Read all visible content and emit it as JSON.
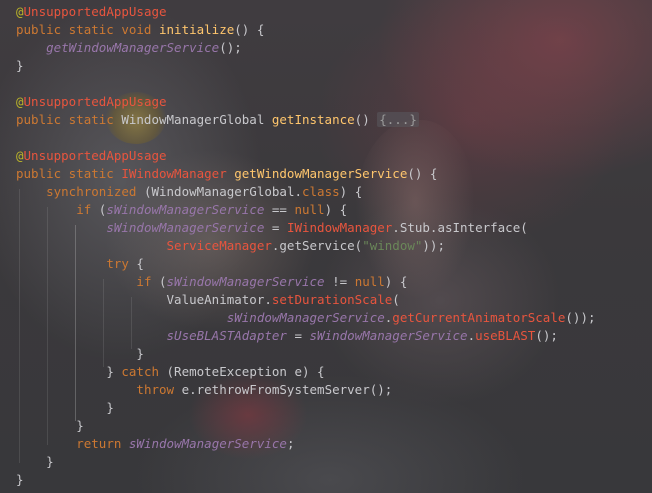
{
  "code": {
    "lines": [
      {
        "tokens": [
          {
            "t": "@",
            "c": "anno"
          },
          {
            "t": "UnsupportedAppUsage",
            "c": "annoname"
          }
        ]
      },
      {
        "tokens": [
          {
            "t": "public static void ",
            "c": "kw"
          },
          {
            "t": "initialize",
            "c": "fn"
          },
          {
            "t": "() {",
            "c": "txt"
          }
        ]
      },
      {
        "tokens": [
          {
            "t": "    ",
            "c": "txt"
          },
          {
            "t": "getWindowManagerService",
            "c": "field"
          },
          {
            "t": "();",
            "c": "txt"
          }
        ]
      },
      {
        "tokens": [
          {
            "t": "}",
            "c": "txt"
          }
        ]
      },
      {
        "tokens": []
      },
      {
        "tokens": [
          {
            "t": "@",
            "c": "anno"
          },
          {
            "t": "UnsupportedAppUsage",
            "c": "annoname"
          }
        ]
      },
      {
        "tokens": [
          {
            "t": "public static ",
            "c": "kw"
          },
          {
            "t": "WindowManagerGlobal ",
            "c": "txt"
          },
          {
            "t": "getInstance",
            "c": "fn"
          },
          {
            "t": "() ",
            "c": "txt"
          },
          {
            "t": "{...}",
            "c": "fold"
          }
        ]
      },
      {
        "tokens": []
      },
      {
        "tokens": [
          {
            "t": "@",
            "c": "anno"
          },
          {
            "t": "UnsupportedAppUsage",
            "c": "annoname"
          }
        ]
      },
      {
        "tokens": [
          {
            "t": "public static ",
            "c": "kw"
          },
          {
            "t": "IWindowManager ",
            "c": "cls"
          },
          {
            "t": "getWindowManagerService",
            "c": "fn"
          },
          {
            "t": "() {",
            "c": "txt"
          }
        ]
      },
      {
        "tokens": [
          {
            "t": "    ",
            "c": "txt"
          },
          {
            "t": "synchronized ",
            "c": "kw"
          },
          {
            "t": "(WindowManagerGlobal.",
            "c": "txt"
          },
          {
            "t": "class",
            "c": "kw"
          },
          {
            "t": ") {",
            "c": "txt"
          }
        ]
      },
      {
        "tokens": [
          {
            "t": "        ",
            "c": "txt"
          },
          {
            "t": "if ",
            "c": "kw"
          },
          {
            "t": "(",
            "c": "txt"
          },
          {
            "t": "sWindowManagerService",
            "c": "field"
          },
          {
            "t": " == ",
            "c": "txt"
          },
          {
            "t": "null",
            "c": "kw"
          },
          {
            "t": ") {",
            "c": "txt"
          }
        ]
      },
      {
        "tokens": [
          {
            "t": "            ",
            "c": "txt"
          },
          {
            "t": "sWindowManagerService",
            "c": "field"
          },
          {
            "t": " = ",
            "c": "txt"
          },
          {
            "t": "IWindowManager",
            "c": "cls"
          },
          {
            "t": ".Stub.asInterface(",
            "c": "txt"
          }
        ]
      },
      {
        "tokens": [
          {
            "t": "                    ",
            "c": "txt"
          },
          {
            "t": "ServiceManager",
            "c": "cls"
          },
          {
            "t": ".getService(",
            "c": "txt"
          },
          {
            "t": "\"window\"",
            "c": "str"
          },
          {
            "t": "));",
            "c": "txt"
          }
        ]
      },
      {
        "tokens": [
          {
            "t": "            ",
            "c": "txt"
          },
          {
            "t": "try ",
            "c": "kw"
          },
          {
            "t": "{",
            "c": "txt"
          }
        ]
      },
      {
        "tokens": [
          {
            "t": "                ",
            "c": "txt"
          },
          {
            "t": "if ",
            "c": "kw"
          },
          {
            "t": "(",
            "c": "txt"
          },
          {
            "t": "sWindowManagerService",
            "c": "field"
          },
          {
            "t": " != ",
            "c": "txt"
          },
          {
            "t": "null",
            "c": "kw"
          },
          {
            "t": ") {",
            "c": "txt"
          }
        ]
      },
      {
        "tokens": [
          {
            "t": "                    ",
            "c": "txt"
          },
          {
            "t": "ValueAnimator.",
            "c": "txt"
          },
          {
            "t": "setDurationScale",
            "c": "call"
          },
          {
            "t": "(",
            "c": "txt"
          }
        ]
      },
      {
        "tokens": [
          {
            "t": "                            ",
            "c": "txt"
          },
          {
            "t": "sWindowManagerService",
            "c": "field"
          },
          {
            "t": ".",
            "c": "txt"
          },
          {
            "t": "getCurrentAnimatorScale",
            "c": "call"
          },
          {
            "t": "());",
            "c": "txt"
          }
        ]
      },
      {
        "tokens": [
          {
            "t": "                    ",
            "c": "txt"
          },
          {
            "t": "sUseBLASTAdapter",
            "c": "field"
          },
          {
            "t": " = ",
            "c": "txt"
          },
          {
            "t": "sWindowManagerService",
            "c": "field"
          },
          {
            "t": ".",
            "c": "txt"
          },
          {
            "t": "useBLAST",
            "c": "call"
          },
          {
            "t": "();",
            "c": "txt"
          }
        ]
      },
      {
        "tokens": [
          {
            "t": "                ",
            "c": "txt"
          },
          {
            "t": "}",
            "c": "txt"
          }
        ]
      },
      {
        "tokens": [
          {
            "t": "            ",
            "c": "txt"
          },
          {
            "t": "} ",
            "c": "txt"
          },
          {
            "t": "catch ",
            "c": "kw"
          },
          {
            "t": "(RemoteException e) {",
            "c": "txt"
          }
        ]
      },
      {
        "tokens": [
          {
            "t": "                ",
            "c": "txt"
          },
          {
            "t": "throw ",
            "c": "kw"
          },
          {
            "t": "e.rethrowFromSystemServer();",
            "c": "txt"
          }
        ]
      },
      {
        "tokens": [
          {
            "t": "            ",
            "c": "txt"
          },
          {
            "t": "}",
            "c": "txt"
          }
        ]
      },
      {
        "tokens": [
          {
            "t": "        ",
            "c": "txt"
          },
          {
            "t": "}",
            "c": "txt"
          }
        ]
      },
      {
        "tokens": [
          {
            "t": "        ",
            "c": "txt"
          },
          {
            "t": "return ",
            "c": "kw"
          },
          {
            "t": "sWindowManagerService",
            "c": "field"
          },
          {
            "t": ";",
            "c": "txt"
          }
        ]
      },
      {
        "tokens": [
          {
            "t": "    ",
            "c": "txt"
          },
          {
            "t": "}",
            "c": "txt"
          }
        ]
      },
      {
        "tokens": [
          {
            "t": "}",
            "c": "txt"
          }
        ]
      }
    ]
  },
  "colors": {
    "keyword": "#cc7832",
    "annotation": "#bbb529",
    "annotation_name": "#e8553e",
    "method_declaration": "#ffc66d",
    "static_field": "#9876aa",
    "class_reference": "#e8553e",
    "string": "#6a8759",
    "plain": "#c8c8cc"
  }
}
